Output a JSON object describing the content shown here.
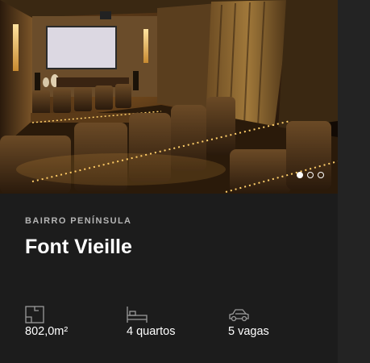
{
  "listing": {
    "neighborhood": "BAIRRO PENÍNSULA",
    "title": "Font Vieille",
    "photo": {
      "description": "home theater",
      "total_images": 3,
      "active_index": 0
    },
    "features": [
      {
        "icon": "area-icon",
        "value": "802,0m²"
      },
      {
        "icon": "bed-icon",
        "value": "4 quartos"
      },
      {
        "icon": "car-icon",
        "value": "5 vagas"
      }
    ]
  },
  "colors": {
    "background": "#1c1c1c",
    "eyebrow": "#b5b5b5",
    "icon": "#9a9a9a",
    "text": "#ffffff"
  }
}
